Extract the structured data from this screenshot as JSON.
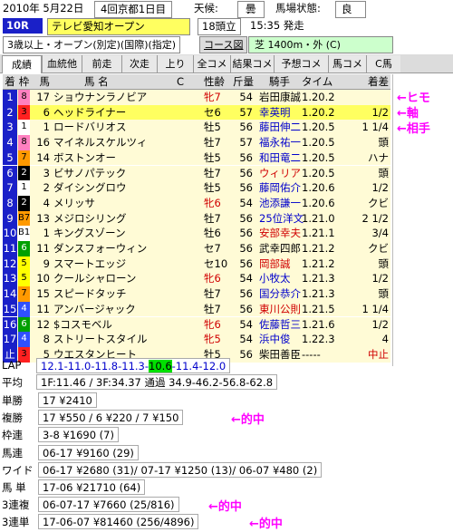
{
  "header": {
    "date": "2010年 5月22日",
    "meeting": "4回京都1日目",
    "weather_label": "天候:",
    "weather": "曇",
    "track_label": "馬場状態:",
    "track": "良",
    "race_no": "10R",
    "race_name": "テレビ愛知オープン",
    "field": "18頭立",
    "start_time": "15:35 発走",
    "conditions": "3歳以上・オープン(別定)(国際)(指定)",
    "course_label": "コース図",
    "course": "芝 1400m・外 (C)"
  },
  "tabs": [
    "成績",
    "血統他",
    "前走",
    "次走",
    "上り",
    "全コメ",
    "結果コメ",
    "予想コメ",
    "馬コメ",
    "C馬"
  ],
  "columns": [
    "着",
    "枠",
    "馬",
    "馬 名",
    "C",
    "性齢",
    "斤量",
    "騎手",
    "タイム",
    "着差"
  ],
  "rows": [
    {
      "place": "1",
      "waku": "8",
      "num": "17",
      "name": "ショウナンラノビア",
      "sex": "牝7",
      "kin": "54",
      "jockey": "岩田康誠",
      "time": "1.20.2",
      "margin": "",
      "pc": "#0000ff",
      "jc": "#000",
      "sc": "#d00000",
      "hl": false
    },
    {
      "place": "2",
      "waku": "3",
      "num": "6",
      "name": "ヘッドライナー",
      "sex": "セ6",
      "kin": "57",
      "jockey": "幸英明",
      "time": "1.20.2",
      "margin": "1/2",
      "pc": "#0000ff",
      "jc": "#0000cc",
      "sc": "#000",
      "hl": true
    },
    {
      "place": "3",
      "waku": "1",
      "num": "1",
      "name": "ロードバリオス",
      "sex": "牡5",
      "kin": "56",
      "jockey": "藤田伸二",
      "time": "1.20.5",
      "margin": "1 1/4",
      "pc": "#0000ff",
      "jc": "#0000cc",
      "sc": "#000",
      "hl": false
    },
    {
      "place": "4",
      "waku": "8",
      "num": "16",
      "name": "マイネルスケルツィ",
      "sex": "牡7",
      "kin": "57",
      "jockey": "福永祐一",
      "time": "1.20.5",
      "margin": "頭",
      "pc": "#0000ff",
      "jc": "#0000cc",
      "sc": "#000",
      "hl": false
    },
    {
      "place": "5",
      "waku": "7",
      "num": "14",
      "name": "ボストンオー",
      "sex": "牡5",
      "kin": "56",
      "jockey": "和田竜二",
      "time": "1.20.5",
      "margin": "ハナ",
      "pc": "#0000ff",
      "jc": "#0000cc",
      "sc": "#000",
      "hl": false
    },
    {
      "place": "6",
      "waku": "2",
      "num": "3",
      "name": "ビサノパテック",
      "sex": "牡7",
      "kin": "56",
      "jockey": "ウィリア",
      "time": "1.20.5",
      "margin": "頭",
      "pc": "#0000ff",
      "jc": "#d00000",
      "sc": "#000",
      "hl": false
    },
    {
      "place": "7",
      "waku": "1",
      "num": "2",
      "name": "ダイシングロウ",
      "sex": "牡5",
      "kin": "56",
      "jockey": "藤岡佑介",
      "time": "1.20.6",
      "margin": "1/2",
      "pc": "#0000ff",
      "jc": "#0000cc",
      "sc": "#000",
      "hl": false
    },
    {
      "place": "8",
      "waku": "2",
      "num": "4",
      "name": "メリッサ",
      "sex": "牝6",
      "kin": "54",
      "jockey": "池添謙一",
      "time": "1.20.6",
      "margin": "クビ",
      "pc": "#0000ff",
      "jc": "#0000cc",
      "sc": "#d00000",
      "hl": false
    },
    {
      "place": "9",
      "waku": "B7",
      "num": "13",
      "name": "メジロシリング",
      "sex": "牡7",
      "kin": "56",
      "jockey": "25位洋文",
      "time": "1.21.0",
      "margin": "2 1/2",
      "pc": "#0000ff",
      "jc": "#0000cc",
      "sc": "#000",
      "hl": false
    },
    {
      "place": "10",
      "waku": "B1",
      "num": "1",
      "name": "キングスゾーン",
      "sex": "牡6",
      "kin": "56",
      "jockey": "安部幸夫",
      "time": "1.21.1",
      "margin": "3/4",
      "pc": "#0000ff",
      "jc": "#d00000",
      "sc": "#000",
      "hl": false
    },
    {
      "place": "11",
      "waku": "6",
      "num": "11",
      "name": "ダンスフォーウィン",
      "sex": "セ7",
      "kin": "56",
      "jockey": "武幸四郎",
      "time": "1.21.2",
      "margin": "クビ",
      "pc": "#0000ff",
      "jc": "#000",
      "sc": "#000",
      "hl": false
    },
    {
      "place": "12",
      "waku": "5",
      "num": "9",
      "name": "スマートエッジ",
      "sex": "セ10",
      "kin": "56",
      "jockey": "岡部誠",
      "time": "1.21.2",
      "margin": "頭",
      "pc": "#0000ff",
      "jc": "#d00000",
      "sc": "#000",
      "hl": false
    },
    {
      "place": "13",
      "waku": "5",
      "num": "10",
      "name": "クールシャローン",
      "sex": "牝6",
      "kin": "54",
      "jockey": "小牧太",
      "time": "1.21.3",
      "margin": "1/2",
      "pc": "#0000ff",
      "jc": "#0000cc",
      "sc": "#d00000",
      "hl": false
    },
    {
      "place": "14",
      "waku": "7",
      "num": "15",
      "name": "スピードタッチ",
      "sex": "牡7",
      "kin": "56",
      "jockey": "国分恭介",
      "time": "1.21.3",
      "margin": "頭",
      "pc": "#0000ff",
      "jc": "#0000cc",
      "sc": "#000",
      "hl": false
    },
    {
      "place": "15",
      "waku": "4",
      "num": "11",
      "name": "アンバージャック",
      "sex": "牡7",
      "kin": "56",
      "jockey": "東川公則",
      "time": "1.21.5",
      "margin": "1 1/4",
      "pc": "#0000ff",
      "jc": "#d00000",
      "sc": "#000",
      "hl": false
    },
    {
      "place": "16",
      "waku": "6",
      "num": "12",
      "name": "$コスモベル",
      "sex": "牝6",
      "kin": "54",
      "jockey": "佐藤哲三",
      "time": "1.21.6",
      "margin": "1/2",
      "pc": "#0000ff",
      "jc": "#0000cc",
      "sc": "#d00000",
      "hl": false
    },
    {
      "place": "17",
      "waku": "4",
      "num": "8",
      "name": "ストリートスタイル",
      "sex": "牝5",
      "kin": "54",
      "jockey": "浜中俊",
      "time": "1.22.3",
      "margin": "4",
      "pc": "#0000ff",
      "jc": "#0000cc",
      "sc": "#d00000",
      "hl": false
    },
    {
      "place": "止",
      "waku": "3",
      "num": "5",
      "name": "ウエスタンヒート",
      "sex": "牡5",
      "kin": "56",
      "jockey": "柴田善臣",
      "time": "-----",
      "margin": "中止",
      "pc": "#0000ff",
      "jc": "#000",
      "sc": "#000",
      "hl": false
    }
  ],
  "waku_colors": {
    "1": "#ffffff",
    "2": "#000000",
    "3": "#ff2020",
    "4": "#3050ff",
    "5": "#ffff00",
    "6": "#00a000",
    "7": "#ff9900",
    "8": "#ff80c0"
  },
  "annotations": [
    "←ヒモ",
    "←軸",
    "←相手"
  ],
  "lap": {
    "label": "LAP",
    "pre": "12.1-11.0-11.8-11.3-",
    "hl": "10.6",
    "post": "-11.4-12.0"
  },
  "pace": {
    "label": "平均",
    "text": "1F:11.46 / 3F:34.37  通過  34.9-46.2-56.8-62.8"
  },
  "payouts": [
    {
      "label": "単勝",
      "text": "17 ¥2410",
      "note": ""
    },
    {
      "label": "複勝",
      "text": "17 ¥550 / 6 ¥220 / 7 ¥150",
      "note": "←的中"
    },
    {
      "label": "枠連",
      "text": "3-8 ¥1690 (7)",
      "note": ""
    },
    {
      "label": "馬連",
      "text": "06-17 ¥9160 (29)",
      "note": ""
    },
    {
      "label": "ワイド",
      "text": "06-17 ¥2680 (31)/ 07-17 ¥1250 (13)/ 06-07 ¥480 (2)",
      "note": ""
    },
    {
      "label": "馬 単",
      "text": "17-06 ¥21710 (64)",
      "note": ""
    },
    {
      "label": "3連複",
      "text": "06-07-17 ¥7660 (25/816)",
      "note": "←的中"
    },
    {
      "label": "3連単",
      "text": "17-06-07 ¥81460 (256/4896)",
      "note": "←的中"
    }
  ]
}
